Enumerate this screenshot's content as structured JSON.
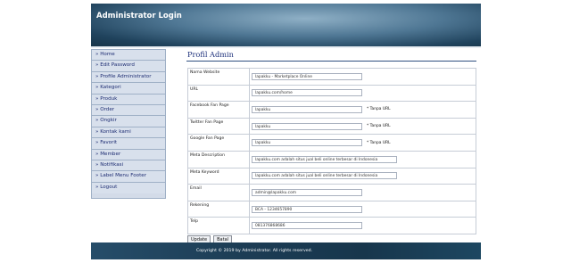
{
  "header": {
    "title": "Administrator Login"
  },
  "sidebar": {
    "items": [
      {
        "label": "» Home"
      },
      {
        "label": "» Edit Password"
      },
      {
        "label": "» Profile Administrator"
      },
      {
        "label": "» Kategori"
      },
      {
        "label": "» Produk"
      },
      {
        "label": "» Order"
      },
      {
        "label": "» Ongkir"
      },
      {
        "label": "» Kontak kami"
      },
      {
        "label": "» Favorit"
      },
      {
        "label": "» Member"
      },
      {
        "label": "» Notifikasi"
      },
      {
        "label": "» Label Menu Footer"
      },
      {
        "label": "» Logout"
      }
    ]
  },
  "main": {
    "title": "Profil Admin",
    "fields": [
      {
        "label": "Nama Website",
        "value": "lapakku - Marketplace Online",
        "note": ""
      },
      {
        "label": "URL",
        "value": "lapakku.com/home",
        "note": ""
      },
      {
        "label": "Facebook Fan Page",
        "value": "lapakku",
        "note": "* Tanpa URL"
      },
      {
        "label": "Twitter Fan Page",
        "value": "lapakku",
        "note": "* Tanpa URL"
      },
      {
        "label": "Google Fan Page",
        "value": "lapakku",
        "note": "* Tanpa URL"
      },
      {
        "label": "Meta Description",
        "value": "lapakku.com adalah situs jual beli online terbesar di Indonesia",
        "note": ""
      },
      {
        "label": "Meta Keyword",
        "value": "lapakku.com adalah situs jual beli online terbesar di Indonesia",
        "note": ""
      },
      {
        "label": "Email",
        "value": "admin@lapakku.com",
        "note": ""
      },
      {
        "label": "Rekening",
        "value": "BCA - 1234657890",
        "note": ""
      },
      {
        "label": "Telp",
        "value": "081376868686",
        "note": ""
      }
    ],
    "buttons": {
      "update": "Update",
      "batal": "Batal"
    }
  },
  "footer": {
    "text": "Copyright © 2019 by Administrator. All rights reserved."
  }
}
